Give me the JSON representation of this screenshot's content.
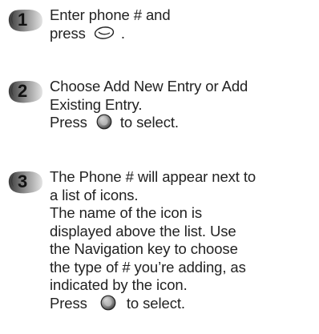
{
  "steps": [
    {
      "number": "1",
      "line1": "Enter phone # and",
      "line2_prefix": "press",
      "line2_icon": "send-key-icon",
      "line2_suffix": "."
    },
    {
      "number": "2",
      "line1": "Choose Add New Entry or Add",
      "line2": "Existing Entry.",
      "line3_prefix": "Press",
      "line3_icon": "select-key-icon",
      "line3_suffix": "to select."
    },
    {
      "number": "3",
      "lines": [
        "The Phone # will appear next to",
        "a list of icons.",
        "The name of the icon is",
        "displayed above the list. Use",
        "the Navigation key to choose",
        "the type of # you’re adding, as",
        "indicated by the icon."
      ],
      "last_prefix": "Press",
      "last_icon": "select-key-icon",
      "last_suffix": "to select."
    }
  ],
  "colors": {
    "text": "#222222",
    "badge_dark": "#3a3a3a",
    "badge_light": "#d6d6d6"
  }
}
